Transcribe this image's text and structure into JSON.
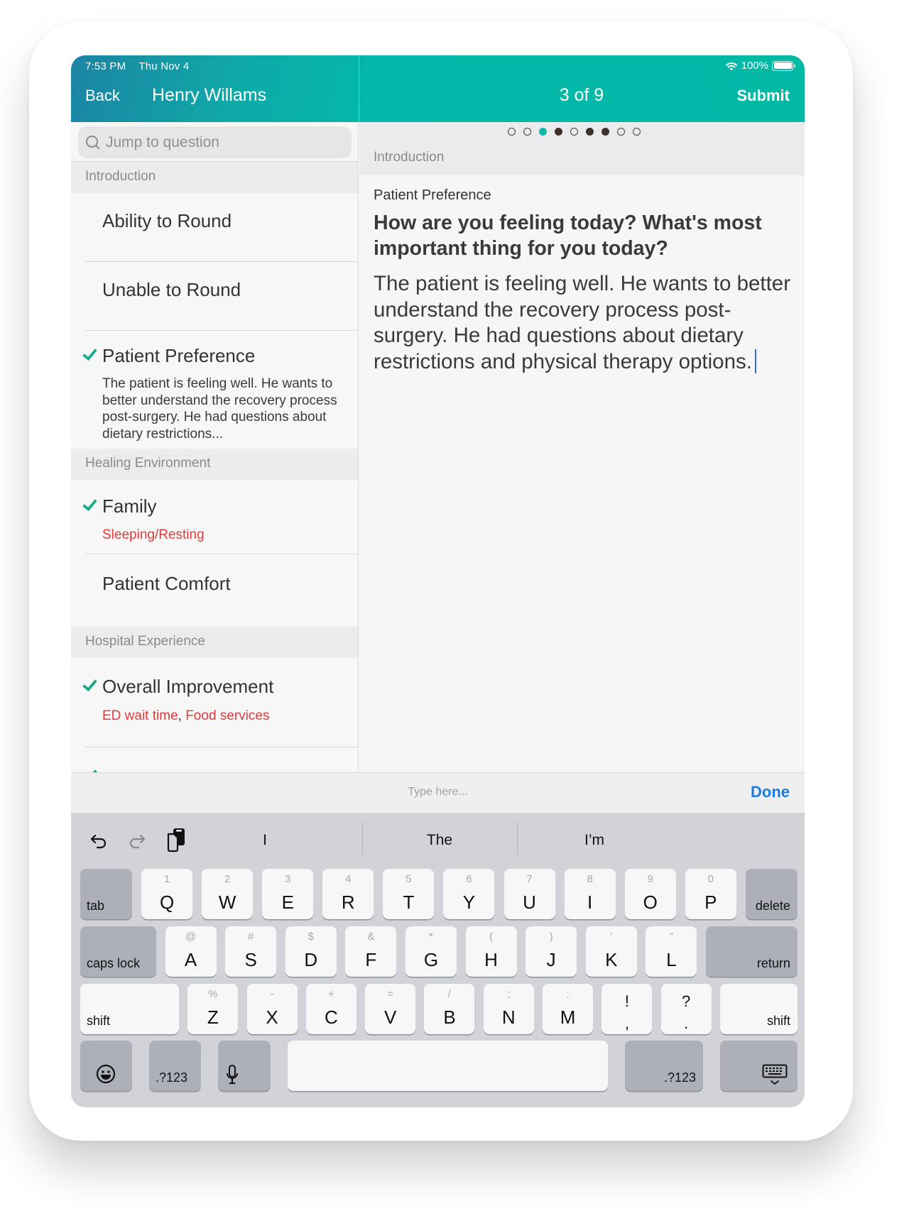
{
  "status_bar": {
    "time": "7:53 PM",
    "date": "Thu Nov 4",
    "battery": "100%",
    "battery_level_percent": 100
  },
  "nav": {
    "back_label": "Back",
    "patient_name": "Henry Willams",
    "progress_label": "3 of 9",
    "submit_label": "Submit"
  },
  "sidebar": {
    "search_placeholder": "Jump to question",
    "sections": [
      {
        "title": "Introduction",
        "items": [
          {
            "title": "Ability to Round",
            "completed": false
          },
          {
            "title": "Unable to Round",
            "completed": false
          },
          {
            "title": "Patient Preference",
            "completed": true,
            "summary": "The patient is feeling well. He wants to better understand the recovery process post-surgery. He had questions about dietary restrictions..."
          }
        ]
      },
      {
        "title": "Healing Environment",
        "items": [
          {
            "title": "Family",
            "completed": true,
            "tags": [
              "Sleeping/Resting"
            ]
          },
          {
            "title": "Patient Comfort",
            "completed": false
          }
        ]
      },
      {
        "title": "Hospital Experience",
        "items": [
          {
            "title": "Overall Improvement",
            "completed": true,
            "tags": [
              "ED wait time",
              "Food services"
            ],
            "tag_separator": ", "
          }
        ]
      }
    ]
  },
  "pagination": {
    "total": 9,
    "current_index": 2,
    "states": [
      "open",
      "open",
      "current",
      "filled",
      "open",
      "filled",
      "filled",
      "open",
      "open"
    ]
  },
  "question": {
    "section": "Introduction",
    "label": "Patient Preference",
    "text": "How are you feeling today? What's most important thing for you today?",
    "answer": "The patient is feeling well. He wants to better understand the recovery process post-surgery. He had questions about dietary restrictions and physical therapy options."
  },
  "input_bar": {
    "placeholder": "Type here...",
    "done_label": "Done"
  },
  "keyboard": {
    "suggestions": [
      "I",
      "The",
      "I’m"
    ],
    "row1": [
      {
        "main": "Q",
        "alt": "1"
      },
      {
        "main": "W",
        "alt": "2"
      },
      {
        "main": "E",
        "alt": "3"
      },
      {
        "main": "R",
        "alt": "4"
      },
      {
        "main": "T",
        "alt": "5"
      },
      {
        "main": "Y",
        "alt": "6"
      },
      {
        "main": "U",
        "alt": "7"
      },
      {
        "main": "I",
        "alt": "8"
      },
      {
        "main": "O",
        "alt": "9"
      },
      {
        "main": "P",
        "alt": "0"
      }
    ],
    "row2": [
      {
        "main": "A",
        "alt": "@"
      },
      {
        "main": "S",
        "alt": "#"
      },
      {
        "main": "D",
        "alt": "$"
      },
      {
        "main": "F",
        "alt": "&"
      },
      {
        "main": "G",
        "alt": "*"
      },
      {
        "main": "H",
        "alt": "("
      },
      {
        "main": "J",
        "alt": ")"
      },
      {
        "main": "K",
        "alt": "’"
      },
      {
        "main": "L",
        "alt": "”"
      }
    ],
    "row3": [
      {
        "main": "Z",
        "alt": "%"
      },
      {
        "main": "X",
        "alt": "-"
      },
      {
        "main": "C",
        "alt": "+"
      },
      {
        "main": "V",
        "alt": "="
      },
      {
        "main": "B",
        "alt": "/"
      },
      {
        "main": "N",
        "alt": ";"
      },
      {
        "main": "M",
        "alt": ":"
      },
      {
        "main": ",",
        "alt": "!"
      },
      {
        "main": ".",
        "alt": "?"
      }
    ],
    "tab": "tab",
    "delete": "delete",
    "caps_lock": "caps lock",
    "return": "return",
    "shift": "shift",
    "numbers": ".?123"
  },
  "colors": {
    "accent_teal": "#02b9a6",
    "check_green": "#1aa88a",
    "tag_red": "#e23b3b",
    "link_blue": "#1a7be0",
    "caret_blue": "#2f6ee6"
  }
}
